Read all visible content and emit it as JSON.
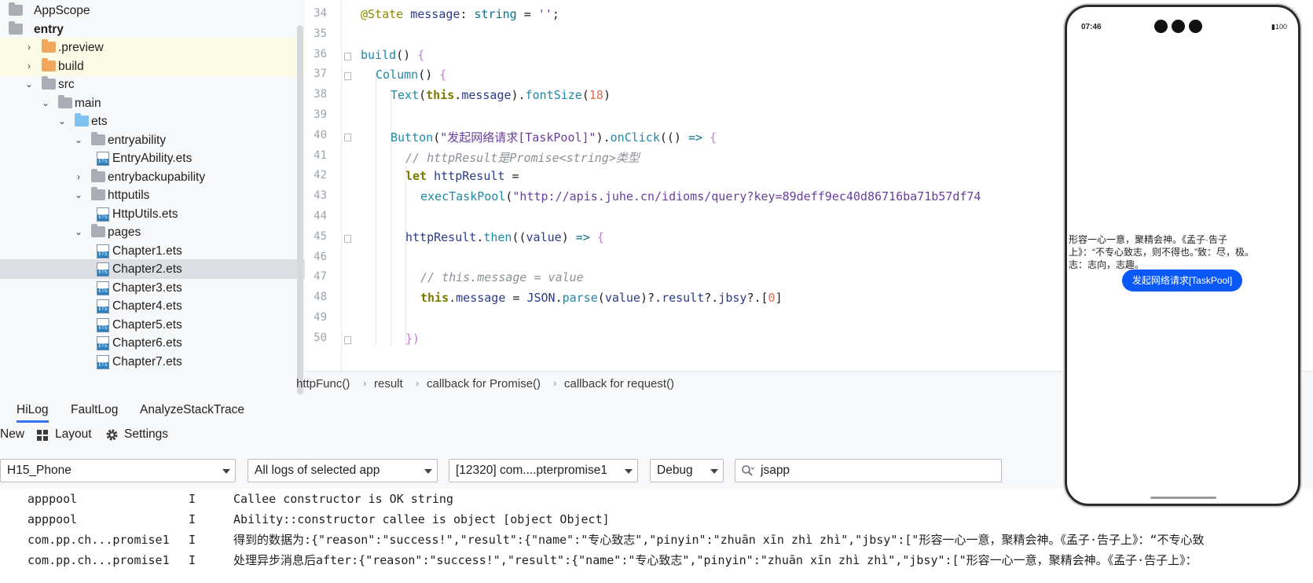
{
  "tree": {
    "items": [
      {
        "label": "AppScope",
        "icon": "folder-icon",
        "color": "gray",
        "chevron": "",
        "level": 0,
        "bold": false,
        "state": ""
      },
      {
        "label": "entry",
        "icon": "module-folder-icon",
        "color": "gray",
        "chevron": "",
        "level": 0,
        "bold": true,
        "state": ""
      },
      {
        "label": ".preview",
        "icon": "folder-icon",
        "color": "orange",
        "chevron": "›",
        "level": 1,
        "bold": false,
        "state": "hl"
      },
      {
        "label": "build",
        "icon": "folder-icon",
        "color": "orange",
        "chevron": "›",
        "level": 1,
        "bold": false,
        "state": "hl"
      },
      {
        "label": "src",
        "icon": "folder-icon",
        "color": "gray",
        "chevron": "⌄",
        "level": 1,
        "bold": false,
        "state": ""
      },
      {
        "label": "main",
        "icon": "folder-icon",
        "color": "gray",
        "chevron": "⌄",
        "level": 2,
        "bold": false,
        "state": ""
      },
      {
        "label": "ets",
        "icon": "folder-icon",
        "color": "blue",
        "chevron": "⌄",
        "level": 3,
        "bold": false,
        "state": ""
      },
      {
        "label": "entryability",
        "icon": "folder-icon",
        "color": "gray",
        "chevron": "⌄",
        "level": 4,
        "bold": false,
        "state": ""
      },
      {
        "label": "EntryAbility.ets",
        "icon": "ets-file-icon",
        "color": "",
        "chevron": "",
        "level": 5,
        "bold": false,
        "state": ""
      },
      {
        "label": "entrybackupability",
        "icon": "folder-icon",
        "color": "gray",
        "chevron": "›",
        "level": 4,
        "bold": false,
        "state": ""
      },
      {
        "label": "httputils",
        "icon": "folder-icon",
        "color": "gray",
        "chevron": "⌄",
        "level": 4,
        "bold": false,
        "state": ""
      },
      {
        "label": "HttpUtils.ets",
        "icon": "ets-file-icon",
        "color": "",
        "chevron": "",
        "level": 5,
        "bold": false,
        "state": ""
      },
      {
        "label": "pages",
        "icon": "folder-icon",
        "color": "gray",
        "chevron": "⌄",
        "level": 4,
        "bold": false,
        "state": ""
      },
      {
        "label": "Chapter1.ets",
        "icon": "ets-file-icon",
        "color": "",
        "chevron": "",
        "level": 5,
        "bold": false,
        "state": ""
      },
      {
        "label": "Chapter2.ets",
        "icon": "ets-file-icon",
        "color": "",
        "chevron": "",
        "level": 5,
        "bold": false,
        "state": "sel"
      },
      {
        "label": "Chapter3.ets",
        "icon": "ets-file-icon",
        "color": "",
        "chevron": "",
        "level": 5,
        "bold": false,
        "state": ""
      },
      {
        "label": "Chapter4.ets",
        "icon": "ets-file-icon",
        "color": "",
        "chevron": "",
        "level": 5,
        "bold": false,
        "state": ""
      },
      {
        "label": "Chapter5.ets",
        "icon": "ets-file-icon",
        "color": "",
        "chevron": "",
        "level": 5,
        "bold": false,
        "state": ""
      },
      {
        "label": "Chapter6.ets",
        "icon": "ets-file-icon",
        "color": "",
        "chevron": "",
        "level": 5,
        "bold": false,
        "state": ""
      },
      {
        "label": "Chapter7.ets",
        "icon": "ets-file-icon",
        "color": "",
        "chevron": "",
        "level": 5,
        "bold": false,
        "state": ""
      }
    ],
    "file_badge": "ETS"
  },
  "editor": {
    "line_numbers": [
      "34",
      "35",
      "36",
      "37",
      "38",
      "39",
      "40",
      "41",
      "42",
      "43",
      "44",
      "45",
      "46",
      "47",
      "48",
      "49",
      "50"
    ],
    "lines": [
      [
        {
          "t": "@State ",
          "c": "dec"
        },
        {
          "t": "message",
          "c": "id"
        },
        {
          "t": ": ",
          "c": ""
        },
        {
          "t": "string",
          "c": "ty"
        },
        {
          "t": " = ",
          "c": ""
        },
        {
          "t": "''",
          "c": "str"
        },
        {
          "t": ";",
          "c": ""
        }
      ],
      [],
      [
        {
          "t": "build",
          "c": "fn"
        },
        {
          "t": "() ",
          "c": ""
        },
        {
          "t": "{",
          "c": "p"
        }
      ],
      [
        {
          "t": "Column",
          "c": "fn"
        },
        {
          "t": "() ",
          "c": ""
        },
        {
          "t": "{",
          "c": "p"
        }
      ],
      [
        {
          "t": "Text",
          "c": "fn"
        },
        {
          "t": "(",
          "c": ""
        },
        {
          "t": "this",
          "c": "kw"
        },
        {
          "t": ".",
          "c": ""
        },
        {
          "t": "message",
          "c": "id"
        },
        {
          "t": ").",
          "c": ""
        },
        {
          "t": "fontSize",
          "c": "fn"
        },
        {
          "t": "(",
          "c": ""
        },
        {
          "t": "18",
          "c": "num"
        },
        {
          "t": ")",
          "c": ""
        }
      ],
      [],
      [
        {
          "t": "Button",
          "c": "fn"
        },
        {
          "t": "(",
          "c": ""
        },
        {
          "t": "\"发起网络请求[TaskPool]\"",
          "c": "str"
        },
        {
          "t": ").",
          "c": ""
        },
        {
          "t": "onClick",
          "c": "fn"
        },
        {
          "t": "(() ",
          "c": ""
        },
        {
          "t": "=> ",
          "c": "kw2"
        },
        {
          "t": "{",
          "c": "p"
        }
      ],
      [
        {
          "t": "// httpResult是Promise<string>类型",
          "c": "cm"
        }
      ],
      [
        {
          "t": "let ",
          "c": "kw"
        },
        {
          "t": "httpResult",
          "c": "id"
        },
        {
          "t": " =",
          "c": ""
        }
      ],
      [
        {
          "t": "execTaskPool",
          "c": "fn"
        },
        {
          "t": "(",
          "c": ""
        },
        {
          "t": "\"http://apis.juhe.cn/idioms/query?key=89deff9ec40d86716ba71b57df74",
          "c": "str"
        }
      ],
      [],
      [
        {
          "t": "httpResult",
          "c": "id"
        },
        {
          "t": ".",
          "c": ""
        },
        {
          "t": "then",
          "c": "fn"
        },
        {
          "t": "((",
          "c": ""
        },
        {
          "t": "value",
          "c": "id"
        },
        {
          "t": ") ",
          "c": ""
        },
        {
          "t": "=> ",
          "c": "kw2"
        },
        {
          "t": "{",
          "c": "p"
        }
      ],
      [],
      [
        {
          "t": "// this.message = value",
          "c": "cm"
        }
      ],
      [
        {
          "t": "this",
          "c": "kw"
        },
        {
          "t": ".",
          "c": ""
        },
        {
          "t": "message",
          "c": "id"
        },
        {
          "t": " = ",
          "c": ""
        },
        {
          "t": "JSON",
          "c": "id"
        },
        {
          "t": ".",
          "c": ""
        },
        {
          "t": "parse",
          "c": "fn"
        },
        {
          "t": "(",
          "c": ""
        },
        {
          "t": "value",
          "c": "id"
        },
        {
          "t": ")?.",
          "c": ""
        },
        {
          "t": "result",
          "c": "id"
        },
        {
          "t": "?.",
          "c": ""
        },
        {
          "t": "jbsy",
          "c": "id"
        },
        {
          "t": "?.[",
          "c": ""
        },
        {
          "t": "0",
          "c": "num"
        },
        {
          "t": "]",
          "c": ""
        }
      ],
      [],
      [
        {
          "t": "})",
          "c": "p"
        }
      ]
    ],
    "indents": [
      0,
      0,
      0,
      1,
      2,
      0,
      2,
      3,
      3,
      4,
      0,
      3,
      0,
      4,
      4,
      0,
      3
    ]
  },
  "breadcrumbs": [
    "httpFunc()",
    "result",
    "callback for Promise()",
    "callback for request()"
  ],
  "log": {
    "tabs": [
      "HiLog",
      "FaultLog",
      "AnalyzeStackTrace"
    ],
    "tools": {
      "new": "New",
      "layout": "Layout",
      "settings": "Settings"
    },
    "device": "H15_Phone",
    "scope": "All logs of selected app",
    "process": "[12320] com....pterpromise1",
    "level": "Debug",
    "search": "jsapp",
    "rows": [
      {
        "tag": "apppool",
        "lvl": "I",
        "msg": "Callee constructor is OK string"
      },
      {
        "tag": "apppool",
        "lvl": "I",
        "msg": "Ability::constructor callee is object [object Object]"
      },
      {
        "tag": "com.pp.ch...promise1",
        "lvl": "I",
        "msg": "得到的数据为:{\"reason\":\"success!\",\"result\":{\"name\":\"专心致志\",\"pinyin\":\"zhuān xīn zhì zhì\",\"jbsy\":[\"形容一心一意，聚精会神。《孟子·告子上》：“不专心致"
      },
      {
        "tag": "com.pp.ch...promise1",
        "lvl": "I",
        "msg": "处理异步消息后after:{\"reason\":\"success!\",\"result\":{\"name\":\"专心致志\",\"pinyin\":\"zhuān xīn zhì zhì\",\"jbsy\":[\"形容一心一意，聚精会神。《孟子·告子上》："
      }
    ]
  },
  "phone": {
    "time": "07:46",
    "battery": "100",
    "text": "形容一心一意，聚精会神。《孟子·告子上》：“不专心致志，则不得也。”致：尽，极。志：志向，志趣。",
    "button": "发起网络请求[TaskPool]"
  },
  "colors": {
    "accent": "#3574f0",
    "phone_button": "#0a59f7",
    "selection": "#dcdfe4",
    "highlight": "#fbfbe6"
  }
}
